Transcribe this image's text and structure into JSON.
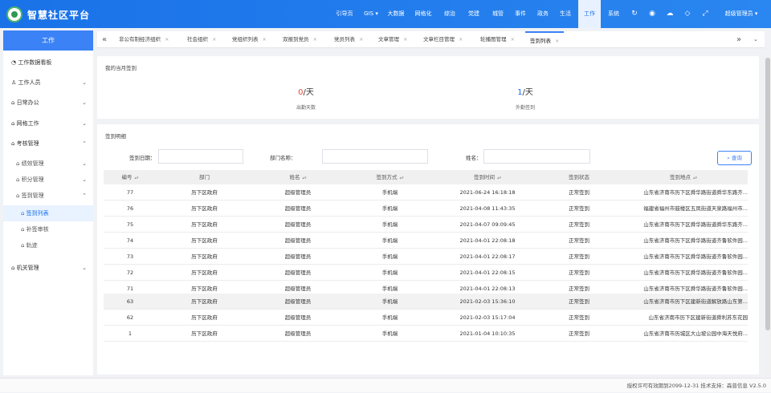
{
  "app": {
    "title": "智慧社区平台"
  },
  "nav": {
    "items": [
      {
        "label": "引导页"
      },
      {
        "label": "GIS ▾"
      },
      {
        "label": "大数据"
      },
      {
        "label": "网格化"
      },
      {
        "label": "综治"
      },
      {
        "label": "党建"
      },
      {
        "label": "城管"
      },
      {
        "label": "事件"
      },
      {
        "label": "政务"
      },
      {
        "label": "生活"
      },
      {
        "label": "工作"
      },
      {
        "label": "系统"
      }
    ],
    "icons": [
      "refresh-icon",
      "notification-icon",
      "cloud-icon",
      "tag-icon",
      "fullscreen-icon"
    ],
    "user": "超级管理员 ▾"
  },
  "sidebar": {
    "header": "工作",
    "items": [
      {
        "label": "工作数据看板"
      },
      {
        "label": "工作人员"
      },
      {
        "label": "日常办公"
      },
      {
        "label": "网格工作"
      },
      {
        "label": "考核管理"
      },
      {
        "label": "绩效管理"
      },
      {
        "label": "积分管理"
      },
      {
        "label": "签到管理"
      },
      {
        "label": "签到列表"
      },
      {
        "label": "补签审核"
      },
      {
        "label": "轨迹"
      },
      {
        "label": "机关管理"
      }
    ]
  },
  "tabs": {
    "items": [
      {
        "label": "非公有制经济组织"
      },
      {
        "label": "社会组织"
      },
      {
        "label": "党组织列表"
      },
      {
        "label": "双报到党员"
      },
      {
        "label": "党员列表"
      },
      {
        "label": "文章管理"
      },
      {
        "label": "文章栏目管理"
      },
      {
        "label": "轮播图管理"
      },
      {
        "label": "签到列表"
      }
    ]
  },
  "summary": {
    "title": "我的当月签到",
    "attendance_value": "0",
    "attendance_unit": "/天",
    "attendance_label": "出勤天数",
    "field_value": "1",
    "field_unit": "/天",
    "field_label": "外勤签到"
  },
  "detail": {
    "title": "签到明细",
    "filters": {
      "date_label": "签到日期：",
      "dept_label": "部门名称：",
      "name_label": "姓名："
    },
    "query_label": "查询",
    "columns": [
      "编号",
      "部门",
      "姓名",
      "签到方式",
      "签到时间",
      "签到状态",
      "签到地点"
    ],
    "rows": [
      {
        "id": "77",
        "dept": "历下区政府",
        "name": "超级管理员",
        "method": "手机端",
        "time": "2021-06-24 16:18:18",
        "status": "正常签到",
        "place": "山东省济南市历下区舜华路街道舜华东路齐..."
      },
      {
        "id": "76",
        "dept": "历下区政府",
        "name": "超级管理员",
        "method": "手机端",
        "time": "2021-04-08 11:43:35",
        "status": "正常签到",
        "place": "福建省福州市鼓楼区五凤街道天泉路福州市..."
      },
      {
        "id": "75",
        "dept": "历下区政府",
        "name": "超级管理员",
        "method": "手机端",
        "time": "2021-04-07 09:09:45",
        "status": "正常签到",
        "place": "山东省济南市历下区舜华路街道舜华东路齐..."
      },
      {
        "id": "74",
        "dept": "历下区政府",
        "name": "超级管理员",
        "method": "手机端",
        "time": "2021-04-01 22:08:18",
        "status": "正常签到",
        "place": "山东省济南市历下区舜华路街道齐鲁软件园..."
      },
      {
        "id": "73",
        "dept": "历下区政府",
        "name": "超级管理员",
        "method": "手机端",
        "time": "2021-04-01 22:08:17",
        "status": "正常签到",
        "place": "山东省济南市历下区舜华路街道齐鲁软件园..."
      },
      {
        "id": "72",
        "dept": "历下区政府",
        "name": "超级管理员",
        "method": "手机端",
        "time": "2021-04-01 22:08:15",
        "status": "正常签到",
        "place": "山东省济南市历下区舜华路街道齐鲁软件园..."
      },
      {
        "id": "71",
        "dept": "历下区政府",
        "name": "超级管理员",
        "method": "手机端",
        "time": "2021-04-01 22:08:13",
        "status": "正常签到",
        "place": "山东省济南市历下区舜华路街道齐鲁软件园..."
      },
      {
        "id": "63",
        "dept": "历下区政府",
        "name": "超级管理员",
        "method": "手机端",
        "time": "2021-02-03 15:36:10",
        "status": "正常签到",
        "place": "山东省济南市历下区建新街道解放路山东第..."
      },
      {
        "id": "62",
        "dept": "历下区政府",
        "name": "超级管理员",
        "method": "手机端",
        "time": "2021-02-03 15:17:04",
        "status": "正常签到",
        "place": "山东省济南市历下区建新街道舜利苏东花园"
      },
      {
        "id": "1",
        "dept": "历下区政府",
        "name": "超级管理员",
        "method": "手机端",
        "time": "2021-01-04 10:10:35",
        "status": "正常签到",
        "place": "山东省济南市历城区大山坡公园中海天悦府..."
      }
    ]
  },
  "footer": {
    "text": "授权许可有效期到2099-12-31  技术支持：森普信息  V2.5.0"
  },
  "colors": {
    "primary": "#1a72e8",
    "accent": "#3b82f6",
    "danger": "#e24a35"
  }
}
